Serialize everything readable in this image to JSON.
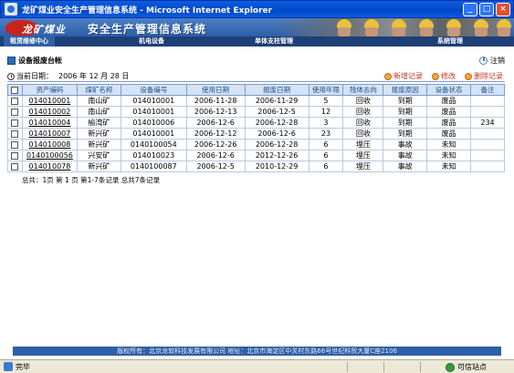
{
  "window": {
    "title": "龙矿煤业安全生产管理信息系统 - Microsoft Internet Explorer",
    "min": "_",
    "max": "□",
    "close": "×"
  },
  "banner": {
    "brand": "龙矿煤业",
    "system_title": "安全生产管理信息系统"
  },
  "nav": {
    "items": [
      {
        "label": "租赁维修中心"
      },
      {
        "label": "机电设备"
      },
      {
        "label": "单体支柱管理"
      },
      {
        "label": "系统管理"
      }
    ]
  },
  "page": {
    "title": "设备报废台帐",
    "logout": "注销",
    "date_label": "当前日期：",
    "date_value": "2006 年 12 月 28 日",
    "actions": {
      "add": "新增记录",
      "edit": "修改",
      "delete": "删除记录"
    }
  },
  "table": {
    "headers": [
      "资产编码",
      "煤矿名称",
      "设备编号",
      "使用日期",
      "报废日期",
      "使用年限",
      "残体去向",
      "报废原因",
      "设备状态",
      "备注"
    ],
    "rows": [
      [
        "014010001",
        "南山矿",
        "014010001",
        "2006-11-28",
        "2006-11-29",
        "5",
        "回收",
        "到期",
        "废品",
        ""
      ],
      [
        "014010002",
        "南山矿",
        "014010001",
        "2006-12-13",
        "2006-12-5",
        "12",
        "回收",
        "到期",
        "废品",
        ""
      ],
      [
        "014010004",
        "榆湾矿",
        "014010006",
        "2006-12-6",
        "2006-12-28",
        "3",
        "回收",
        "到期",
        "废品",
        "234"
      ],
      [
        "014010007",
        "新兴矿",
        "014010001",
        "2006-12-12",
        "2006-12-6",
        "23",
        "回收",
        "到期",
        "废品",
        ""
      ],
      [
        "014010008",
        "新兴矿",
        "0140100054",
        "2006-12-26",
        "2006-12-28",
        "6",
        "埋压",
        "事故",
        "未知",
        ""
      ],
      [
        "0140100056",
        "兴安矿",
        "014010023",
        "2006-12-6",
        "2012-12-26",
        "6",
        "埋压",
        "事故",
        "未知",
        ""
      ],
      [
        "014010078",
        "新兴矿",
        "0140100087",
        "2006-12-5",
        "2010-12-29",
        "6",
        "埋压",
        "事故",
        "未知",
        ""
      ]
    ]
  },
  "pager": {
    "text": "总共：1页  第 1 页  第1-7条记录  总共7条记录"
  },
  "footer": {
    "text": "版权所有：北京龙软科技发展有限公司  地址：北京市海淀区中关村东路66号世纪科贸大厦C座2106"
  },
  "status": {
    "left": "完毕",
    "zone": "可信站点"
  }
}
